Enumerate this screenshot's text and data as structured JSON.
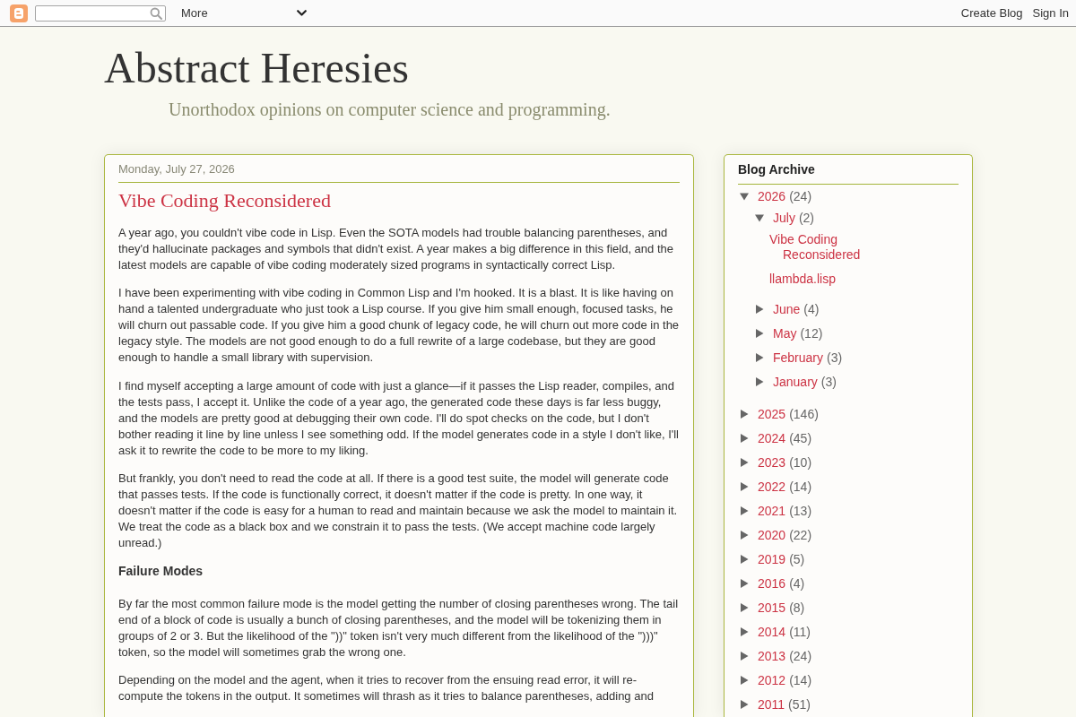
{
  "navbar": {
    "menu": "More",
    "links": [
      "Create Blog",
      "Sign In"
    ]
  },
  "header": {
    "title": "Abstract Heresies",
    "description": "Unorthodox opinions on computer science and programming."
  },
  "post": {
    "date": "Monday, July 27, 2026",
    "title": "Vibe Coding Reconsidered",
    "body": [
      {
        "kind": "paragraph",
        "text": "A year ago, you couldn't vibe code in Lisp. Even the SOTA models had trouble balancing parentheses, and they'd hallucinate packages and symbols that didn't exist. A year makes a big difference in this field, and the latest models are capable of vibe coding moderately sized programs in syntactically correct Lisp."
      },
      {
        "kind": "paragraph",
        "text": "I have been experimenting with vibe coding in Common Lisp and I'm hooked. It is a blast. It is like having on hand a talented undergraduate who just took a Lisp course. If you give him small enough, focused tasks, he will churn out passable code. If you give him a good chunk of legacy code, he will churn out more code in the legacy style. The models are not good enough to do a full rewrite of a large codebase, but they are good enough to handle a small library with supervision."
      },
      {
        "kind": "paragraph",
        "text": "I find myself accepting a large amount of code with just a glance—if it passes the Lisp reader, compiles, and the tests pass, I accept it. Unlike the code of a year ago, the generated code these days is far less buggy, and the models are pretty good at debugging their own code. I'll do spot checks on the code, but I don't bother reading it line by line unless I see something odd. If the model generates code in a style I don't like, I'll ask it to rewrite the code to be more to my liking."
      },
      {
        "kind": "paragraph",
        "text": "But frankly, you don't need to read the code at all. If there is a good test suite, the model will generate code that passes tests. If the code is functionally correct, it doesn't matter if the code is pretty. In one way, it doesn't matter if the code is easy for a human to read and maintain because we ask the model to maintain it. We treat the code as a black box and we constrain it to pass the tests. (We accept machine code largely unread.)"
      },
      {
        "kind": "heading",
        "text": "Failure Modes"
      },
      {
        "kind": "paragraph",
        "text": "By far the most common failure mode is the model getting the number of closing parentheses wrong. The tail end of a block of code is usually a bunch of closing parentheses, and the model will be tokenizing them in groups of 2 or 3. But the likelihood of the \"))\" token isn't very much different from the likelihood of the \")))\" token, so the model will sometimes grab the wrong one."
      },
      {
        "kind": "paragraph",
        "text": "Depending on the model and the agent, when it tries to recover from the ensuing read error, it will re-compute the tokens in the output. It sometimes will thrash as it tries to balance parentheses, adding and"
      }
    ]
  },
  "sidebar": {
    "title": "Blog Archive",
    "archive": [
      {
        "kind": "period",
        "label": "2026",
        "count": "(24)",
        "expanded": true,
        "children": [
          {
            "kind": "period",
            "label": "July",
            "count": "(2)",
            "expanded": true,
            "children": [
              {
                "kind": "post",
                "label": "Vibe Coding Reconsidered"
              },
              {
                "kind": "post",
                "label": "llambda.lisp"
              }
            ]
          },
          {
            "kind": "period",
            "label": "June",
            "count": "(4)",
            "expanded": false
          },
          {
            "kind": "period",
            "label": "May",
            "count": "(12)",
            "expanded": false
          },
          {
            "kind": "period",
            "label": "February",
            "count": "(3)",
            "expanded": false
          },
          {
            "kind": "period",
            "label": "January",
            "count": "(3)",
            "expanded": false
          }
        ]
      },
      {
        "kind": "period",
        "label": "2025",
        "count": "(146)",
        "expanded": false
      },
      {
        "kind": "period",
        "label": "2024",
        "count": "(45)",
        "expanded": false
      },
      {
        "kind": "period",
        "label": "2023",
        "count": "(10)",
        "expanded": false
      },
      {
        "kind": "period",
        "label": "2022",
        "count": "(14)",
        "expanded": false
      },
      {
        "kind": "period",
        "label": "2021",
        "count": "(13)",
        "expanded": false
      },
      {
        "kind": "period",
        "label": "2020",
        "count": "(22)",
        "expanded": false
      },
      {
        "kind": "period",
        "label": "2019",
        "count": "(5)",
        "expanded": false
      },
      {
        "kind": "period",
        "label": "2016",
        "count": "(4)",
        "expanded": false
      },
      {
        "kind": "period",
        "label": "2015",
        "count": "(8)",
        "expanded": false
      },
      {
        "kind": "period",
        "label": "2014",
        "count": "(11)",
        "expanded": false
      },
      {
        "kind": "period",
        "label": "2013",
        "count": "(24)",
        "expanded": false
      },
      {
        "kind": "period",
        "label": "2012",
        "count": "(14)",
        "expanded": false
      },
      {
        "kind": "period",
        "label": "2011",
        "count": "(51)",
        "expanded": false
      }
    ]
  }
}
